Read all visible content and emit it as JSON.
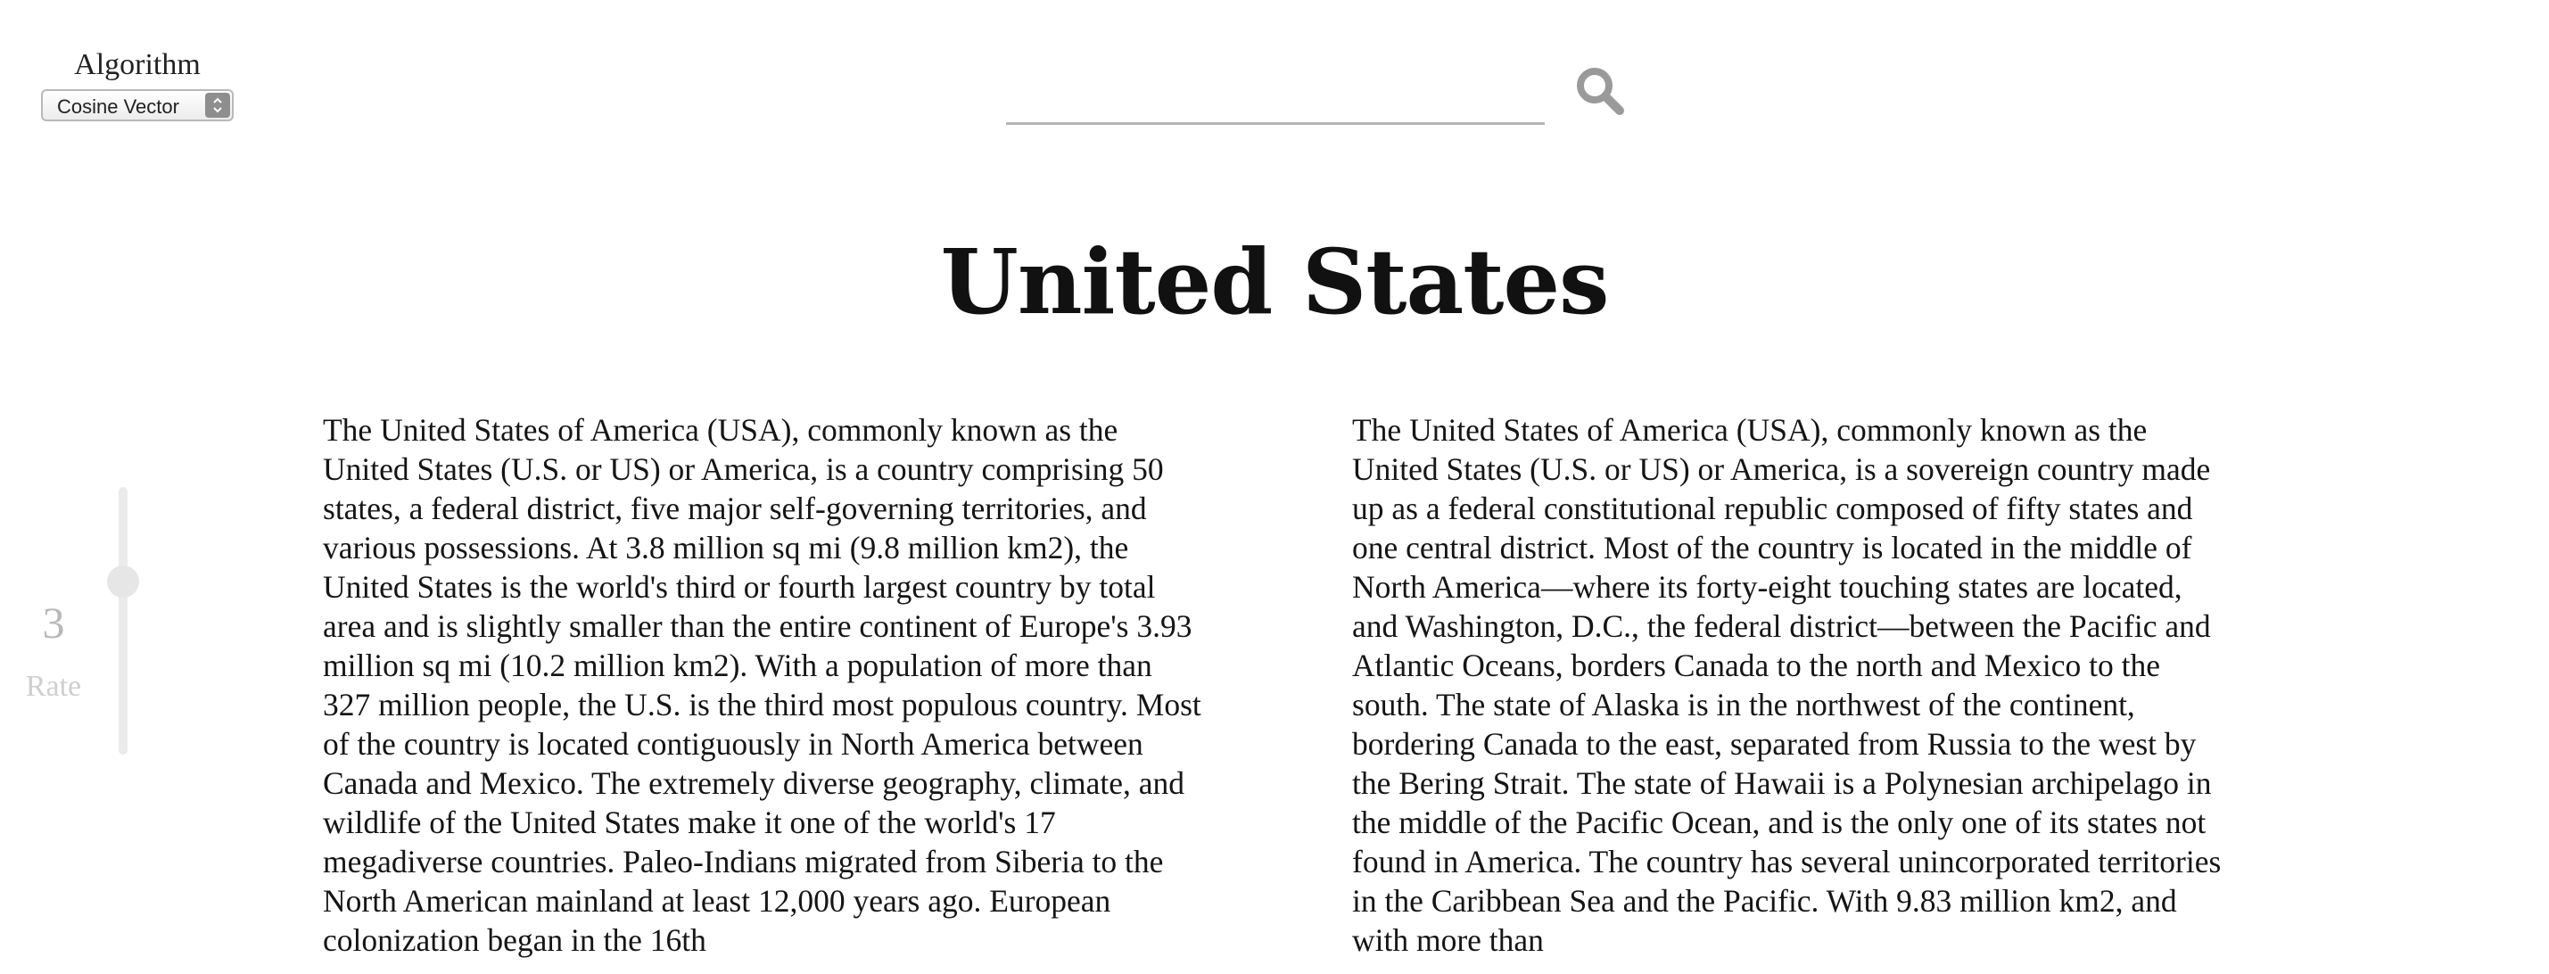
{
  "algorithm": {
    "label": "Algorithm",
    "selected": "Cosine Vector"
  },
  "search": {
    "value": "",
    "placeholder": "",
    "icon": "search-icon"
  },
  "title": "United States",
  "rate": {
    "label": "Rate",
    "value": "3"
  },
  "columns": {
    "left": "The United States of America (USA), commonly known as the United States (U.S. or US) or America, is a country comprising 50 states, a federal district, five major self-governing territories, and various possessions. At 3.8 million sq mi (9.8 million km2), the United States is the world's third or fourth largest country by total area and is slightly smaller than the entire continent of Europe's 3.93 million sq mi (10.2 million km2). With a population of more than 327 million people, the U.S. is the third most populous country. Most of the country is located contiguously in North America between Canada and Mexico. The extremely diverse geography, climate, and wildlife of the United States make it one of the world's 17 megadiverse countries. Paleo-Indians migrated from Siberia to the North American mainland at least 12,000 years ago. European colonization began in the 16th",
    "right": "The United States of America (USA), commonly known as the United States (U.S. or US) or America, is a sovereign country made up as a federal constitutional republic composed of fifty states and one central district. Most of the country is located in the middle of North America—where its forty-eight touching states are located, and Washington, D.C., the federal district—between the Pacific and Atlantic Oceans, borders Canada to the north and Mexico to the south. The state of Alaska is in the northwest of the continent, bordering Canada to the east, separated from Russia to the west by the Bering Strait. The state of Hawaii is a Polynesian archipelago in the middle of the Pacific Ocean, and is the only one of its states not found in America. The country has several unincorporated territories in the Caribbean Sea and the Pacific. With 9.83 million km2, and with more than"
  }
}
